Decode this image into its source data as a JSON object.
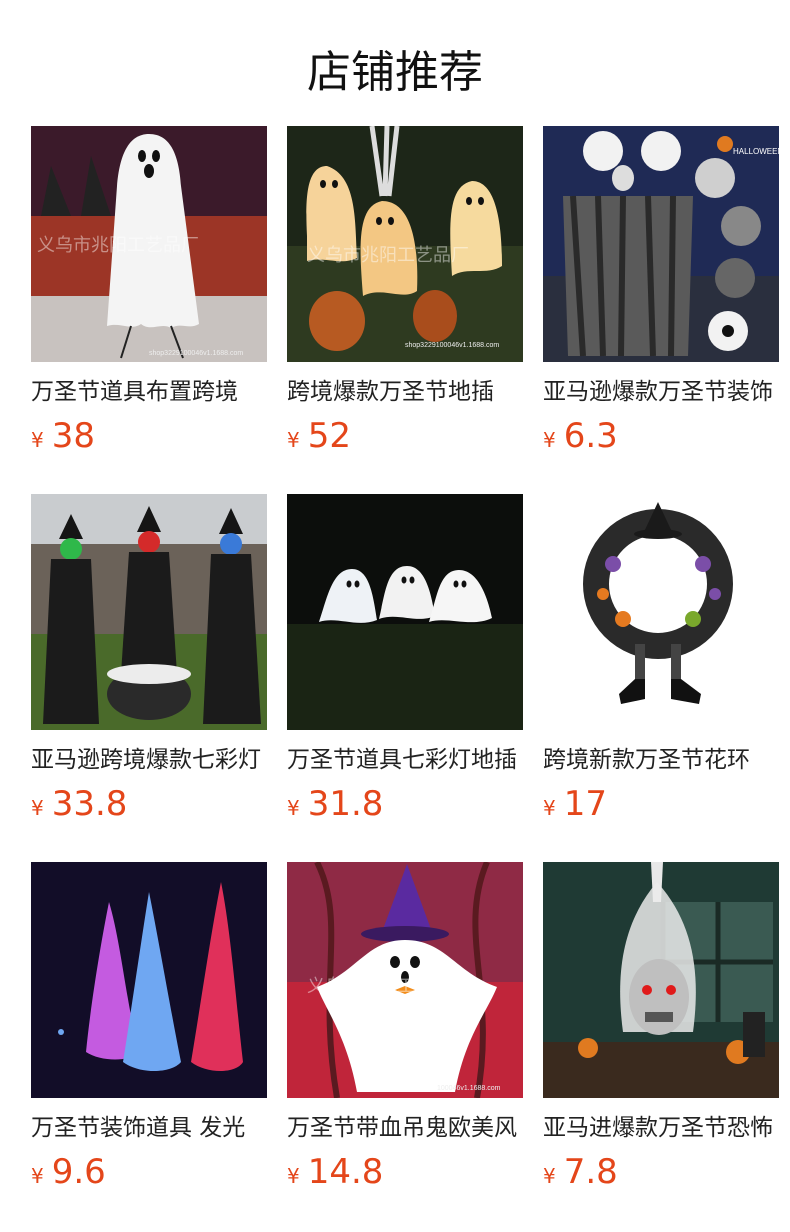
{
  "header": {
    "title": "店铺推荐"
  },
  "products": [
    {
      "title": "万圣节道具布置跨境",
      "currency": "¥",
      "price": "38",
      "image": "ghost-stand-image"
    },
    {
      "title": "跨境爆款万圣节地插",
      "currency": "¥",
      "price": "52",
      "image": "glowing-ghosts-image"
    },
    {
      "title": "亚马逊爆款万圣节装饰",
      "currency": "¥",
      "price": "6.3",
      "image": "hanging-skull-cloth-image"
    },
    {
      "title": "亚马逊跨境爆款七彩灯",
      "currency": "¥",
      "price": "33.8",
      "image": "witch-trio-image"
    },
    {
      "title": "万圣节道具七彩灯地插",
      "currency": "¥",
      "price": "31.8",
      "image": "night-ghosts-image"
    },
    {
      "title": "跨境新款万圣节花环",
      "currency": "¥",
      "price": "17",
      "image": "witch-wreath-image"
    },
    {
      "title": "万圣节装饰道具 发光",
      "currency": "¥",
      "price": "9.6",
      "image": "glowing-hanging-ghosts-image"
    },
    {
      "title": "万圣节带血吊鬼欧美风",
      "currency": "¥",
      "price": "14.8",
      "image": "witch-hat-ghost-image"
    },
    {
      "title": "亚马进爆款万圣节恐怖",
      "currency": "¥",
      "price": "7.8",
      "image": "hanging-skull-ghost-image"
    }
  ],
  "watermarks": {
    "w1": "义乌市兆阳工艺品厂",
    "w1s": "shop3229100046v1.1688.com",
    "w2": "义乌市兆阳工艺品厂",
    "w2s": "shop3229100046v1.1688.com",
    "w3": "HALLOWEEN",
    "w8": "义乌市兆阳工艺品厂",
    "w8s": "100046v1.1688.com"
  }
}
